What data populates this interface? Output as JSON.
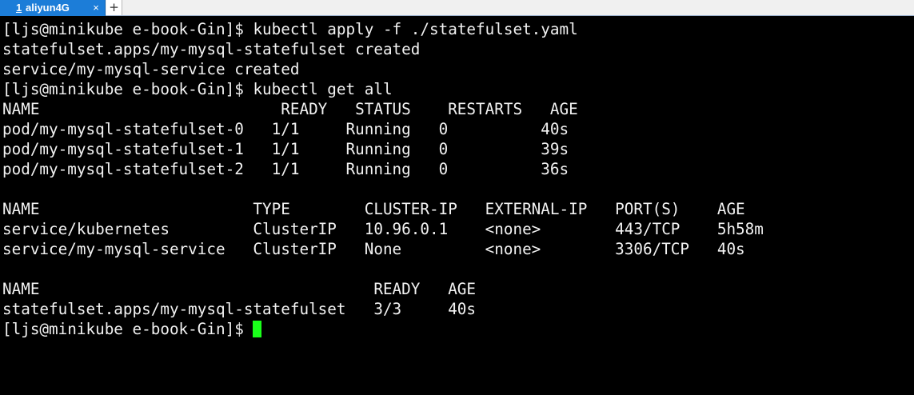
{
  "tab": {
    "number": "1",
    "title": "aliyun4G",
    "close_glyph": "×",
    "new_tab_glyph": "+"
  },
  "colors": {
    "tab_active": "#1c7dd8",
    "terminal_bg": "#000000",
    "terminal_fg": "#f2f2f2",
    "cursor": "#1aff1a"
  },
  "terminal": {
    "prompt": "[ljs@minikube e-book-Gin]$ ",
    "lines": [
      {
        "prompt": "[ljs@minikube e-book-Gin]$ ",
        "command": "kubectl apply -f ./statefulset.yaml"
      },
      {
        "text": "statefulset.apps/my-mysql-statefulset created"
      },
      {
        "text": "service/my-mysql-service created"
      },
      {
        "prompt": "[ljs@minikube e-book-Gin]$ ",
        "command": "kubectl get all"
      },
      {
        "text": "NAME                          READY   STATUS    RESTARTS   AGE"
      },
      {
        "text": "pod/my-mysql-statefulset-0   1/1     Running   0          40s"
      },
      {
        "text": "pod/my-mysql-statefulset-1   1/1     Running   0          39s"
      },
      {
        "text": "pod/my-mysql-statefulset-2   1/1     Running   0          36s"
      },
      {
        "text": ""
      },
      {
        "text": "NAME                       TYPE        CLUSTER-IP   EXTERNAL-IP   PORT(S)    AGE"
      },
      {
        "text": "service/kubernetes         ClusterIP   10.96.0.1    <none>        443/TCP    5h58m"
      },
      {
        "text": "service/my-mysql-service   ClusterIP   None         <none>        3306/TCP   40s"
      },
      {
        "text": ""
      },
      {
        "text": "NAME                                    READY   AGE"
      },
      {
        "text": "statefulset.apps/my-mysql-statefulset   3/3     40s"
      },
      {
        "prompt": "[ljs@minikube e-book-Gin]$ ",
        "command": ""
      }
    ]
  }
}
